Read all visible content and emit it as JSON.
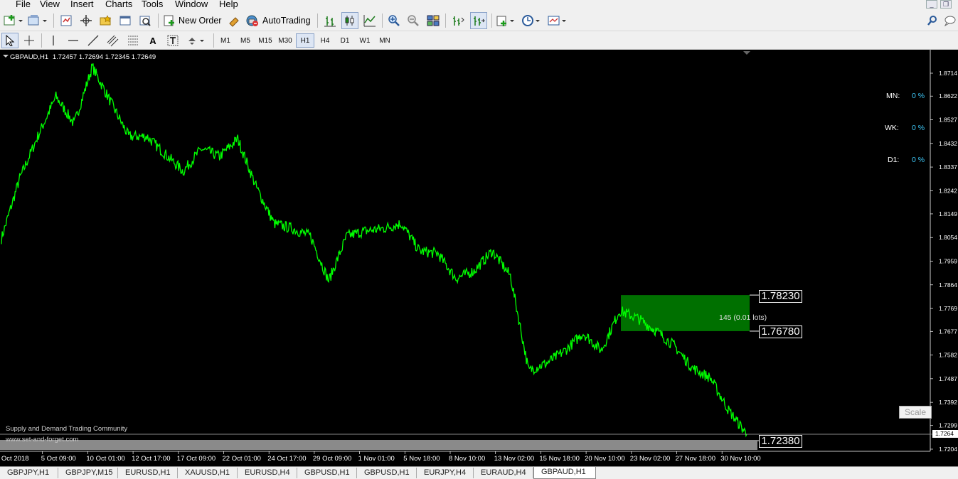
{
  "menu": [
    "File",
    "View",
    "Insert",
    "Charts",
    "Tools",
    "Window",
    "Help"
  ],
  "toolbar": {
    "new_order": "New Order",
    "autotrading": "AutoTrading"
  },
  "timeframes": [
    "M1",
    "M5",
    "M15",
    "M30",
    "H1",
    "H4",
    "D1",
    "W1",
    "MN"
  ],
  "active_timeframe": "H1",
  "chart": {
    "header_symbol": "GBPAUD,H1",
    "header_ohlc": "1.72457 1.72694 1.72345 1.72649",
    "stats": [
      {
        "label": "MN:",
        "value": "0 %"
      },
      {
        "label": "WK:",
        "value": "0 %"
      },
      {
        "label": "D1:",
        "value": "0 %"
      }
    ],
    "price_axis": [
      "1.8714",
      "1.8622",
      "1.8527",
      "1.8432",
      "1.8337",
      "1.8242",
      "1.8149",
      "1.8054",
      "1.7959",
      "1.7864",
      "1.7769",
      "1.7677",
      "1.7582",
      "1.7487",
      "1.7392",
      "1.7299",
      "1.7264",
      "1.7204"
    ],
    "current_price": "1.7264",
    "time_axis": [
      "2 Oct 2018",
      "5 Oct 09:00",
      "10 Oct 01:00",
      "12 Oct 17:00",
      "17 Oct 09:00",
      "22 Oct 01:00",
      "24 Oct 17:00",
      "29 Oct 09:00",
      "1 Nov 01:00",
      "5 Nov 18:00",
      "8 Nov 10:00",
      "13 Nov 02:00",
      "15 Nov 18:00",
      "20 Nov 10:00",
      "23 Nov 02:00",
      "27 Nov 18:00",
      "30 Nov 10:00"
    ],
    "level_labels": [
      "1.78230",
      "1.76780",
      "1.72380"
    ],
    "zone_label": "145 (0.01 lots)",
    "scale_button": "Scale",
    "watermark_line1": "Supply and Demand Trading Community",
    "watermark_line2": "www.set-and-forget.com",
    "line_color": "#00ff00",
    "zone_color": "#007000",
    "chart_data": {
      "type": "line",
      "series": [
        {
          "x": [
            "2 Oct 2018",
            "3 Oct",
            "4 Oct",
            "5 Oct 09:00",
            "8 Oct",
            "10 Oct 01:00",
            "11 Oct",
            "12 Oct 17:00",
            "15 Oct",
            "17 Oct 09:00",
            "18 Oct",
            "19 Oct",
            "22 Oct 01:00",
            "23 Oct",
            "24 Oct 17:00",
            "25 Oct",
            "26 Oct",
            "29 Oct 09:00",
            "30 Oct",
            "1 Nov 01:00",
            "2 Nov",
            "5 Nov 18:00",
            "6 Nov",
            "7 Nov",
            "8 Nov 10:00",
            "9 Nov",
            "12 Nov",
            "13 Nov 02:00",
            "14 Nov",
            "15 Nov 18:00",
            "16 Nov",
            "19 Nov",
            "20 Nov 10:00",
            "21 Nov",
            "22 Nov",
            "23 Nov 02:00",
            "26 Nov",
            "27 Nov 18:00",
            "28 Nov",
            "29 Nov",
            "30 Nov 10:00",
            "3 Dec"
          ],
          "values": [
            1.805,
            1.829,
            1.846,
            1.862,
            1.851,
            1.874,
            1.86,
            1.846,
            1.846,
            1.839,
            1.832,
            1.841,
            1.838,
            1.845,
            1.826,
            1.811,
            1.809,
            1.806,
            1.788,
            1.806,
            1.808,
            1.809,
            1.811,
            1.8,
            1.799,
            1.789,
            1.792,
            1.8,
            1.79,
            1.752,
            1.755,
            1.76,
            1.767,
            1.76,
            1.776,
            1.773,
            1.768,
            1.762,
            1.753,
            1.749,
            1.736,
            1.7264
          ]
        }
      ],
      "ylim": [
        1.7204,
        1.8714
      ],
      "levels": [
        1.7823,
        1.7678,
        1.7238
      ],
      "zone": {
        "from": 1.7678,
        "to": 1.7823,
        "start": "22 Nov"
      }
    }
  },
  "tabs": [
    "GBPJPY,H1",
    "GBPJPY,M15",
    "EURUSD,H1",
    "XAUUSD,H1",
    "EURUSD,H4",
    "GBPUSD,H1",
    "GBPUSD,H1",
    "EURJPY,H4",
    "EURAUD,H4",
    "GBPAUD,H1"
  ],
  "active_tab": "GBPAUD,H1"
}
